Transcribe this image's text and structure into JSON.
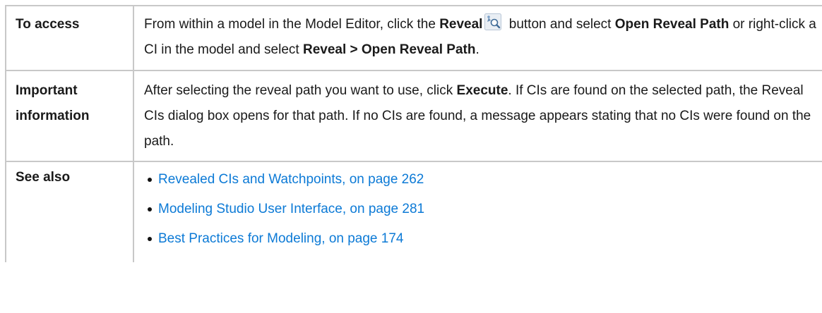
{
  "rows": {
    "access": {
      "label": "To access",
      "text_1": "From within a model in the Model Editor, click the ",
      "bold_reveal": "Reveal",
      "text_2": " button and select ",
      "bold_open": "Open",
      "bold_reveal_path": "Reveal Path",
      "text_3": " or right-click a CI in the model and select ",
      "bold_menu_path": "Reveal > Open Reveal Path",
      "text_4": "."
    },
    "important": {
      "label_line1": "Important",
      "label_line2": "information",
      "text_1": "After selecting the reveal path you want to use, click ",
      "bold_execute": "Execute",
      "text_2": ". If CIs are found on the selected path, the Reveal CIs dialog box opens for that path. If no CIs are found, a message appears stating that no CIs were found on the path."
    },
    "see_also": {
      "label": "See also",
      "links": [
        "Revealed CIs and Watchpoints, on page 262",
        "Modeling Studio User Interface, on page 281",
        "Best Practices for Modeling, on page 174"
      ]
    }
  },
  "colors": {
    "link": "#0c7ad6",
    "border": "#c8c8c8"
  },
  "icons": {
    "reveal": "reveal-magnifier-icon"
  }
}
